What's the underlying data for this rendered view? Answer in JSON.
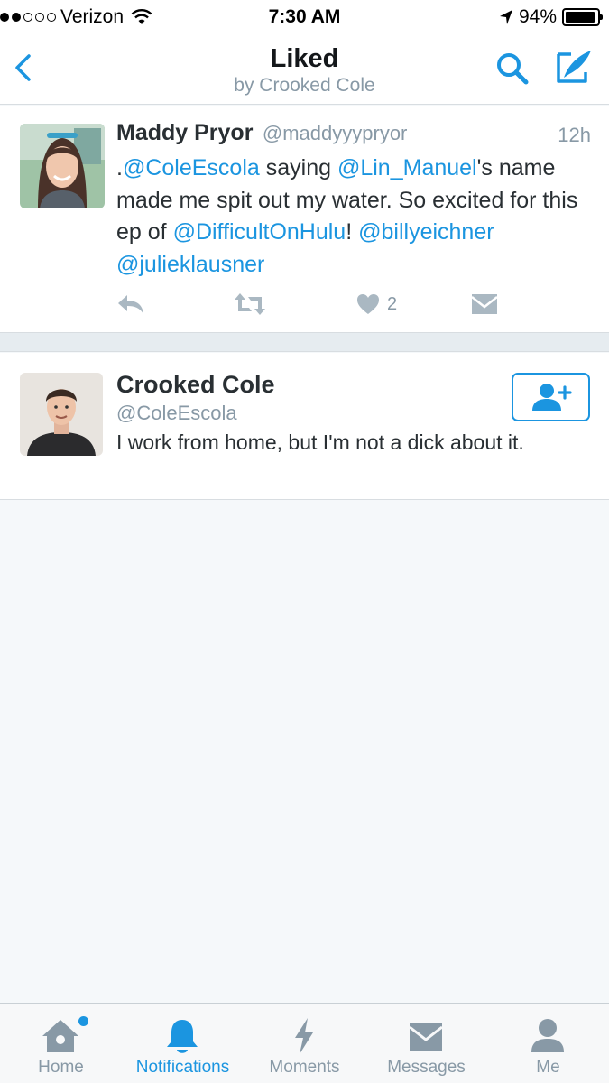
{
  "status_bar": {
    "carrier": "Verizon",
    "time": "7:30 AM",
    "battery": "94%",
    "battery_level": 0.94,
    "signal_bars_filled": 2,
    "signal_bars_total": 5
  },
  "nav": {
    "title": "Liked",
    "subtitle": "by Crooked Cole",
    "back_icon": "chevron-left-icon",
    "search_icon": "search-icon",
    "compose_icon": "compose-icon"
  },
  "tweet": {
    "name": "Maddy Pryor",
    "handle": "@maddyyypryor",
    "time": "12h",
    "text_segments": [
      {
        "t": ".",
        "m": false
      },
      {
        "t": "@ColeEscola",
        "m": true
      },
      {
        "t": " saying ",
        "m": false
      },
      {
        "t": "@Lin_Manuel",
        "m": true
      },
      {
        "t": "'s name made me spit out my water. So excited for this ep of ",
        "m": false
      },
      {
        "t": "@DifficultOnHulu",
        "m": true
      },
      {
        "t": "! ",
        "m": false
      },
      {
        "t": "@billyeichner",
        "m": true
      },
      {
        "t": " ",
        "m": false
      },
      {
        "t": "@julieklausner",
        "m": true
      }
    ],
    "like_count": "2"
  },
  "user_card": {
    "name": "Crooked Cole",
    "handle": "@ColeEscola",
    "bio": "I work from home, but I'm not a dick about it."
  },
  "tabs": [
    {
      "label": "Home",
      "icon": "home-icon",
      "active": false
    },
    {
      "label": "Notifications",
      "icon": "bell-icon",
      "active": true
    },
    {
      "label": "Moments",
      "icon": "lightning-icon",
      "active": false
    },
    {
      "label": "Messages",
      "icon": "envelope-icon",
      "active": false
    },
    {
      "label": "Me",
      "icon": "person-icon",
      "active": false
    }
  ],
  "colors": {
    "accent": "#1b95e0",
    "muted": "#8899a6",
    "text": "#292f33",
    "background": "#f5f8fa"
  }
}
